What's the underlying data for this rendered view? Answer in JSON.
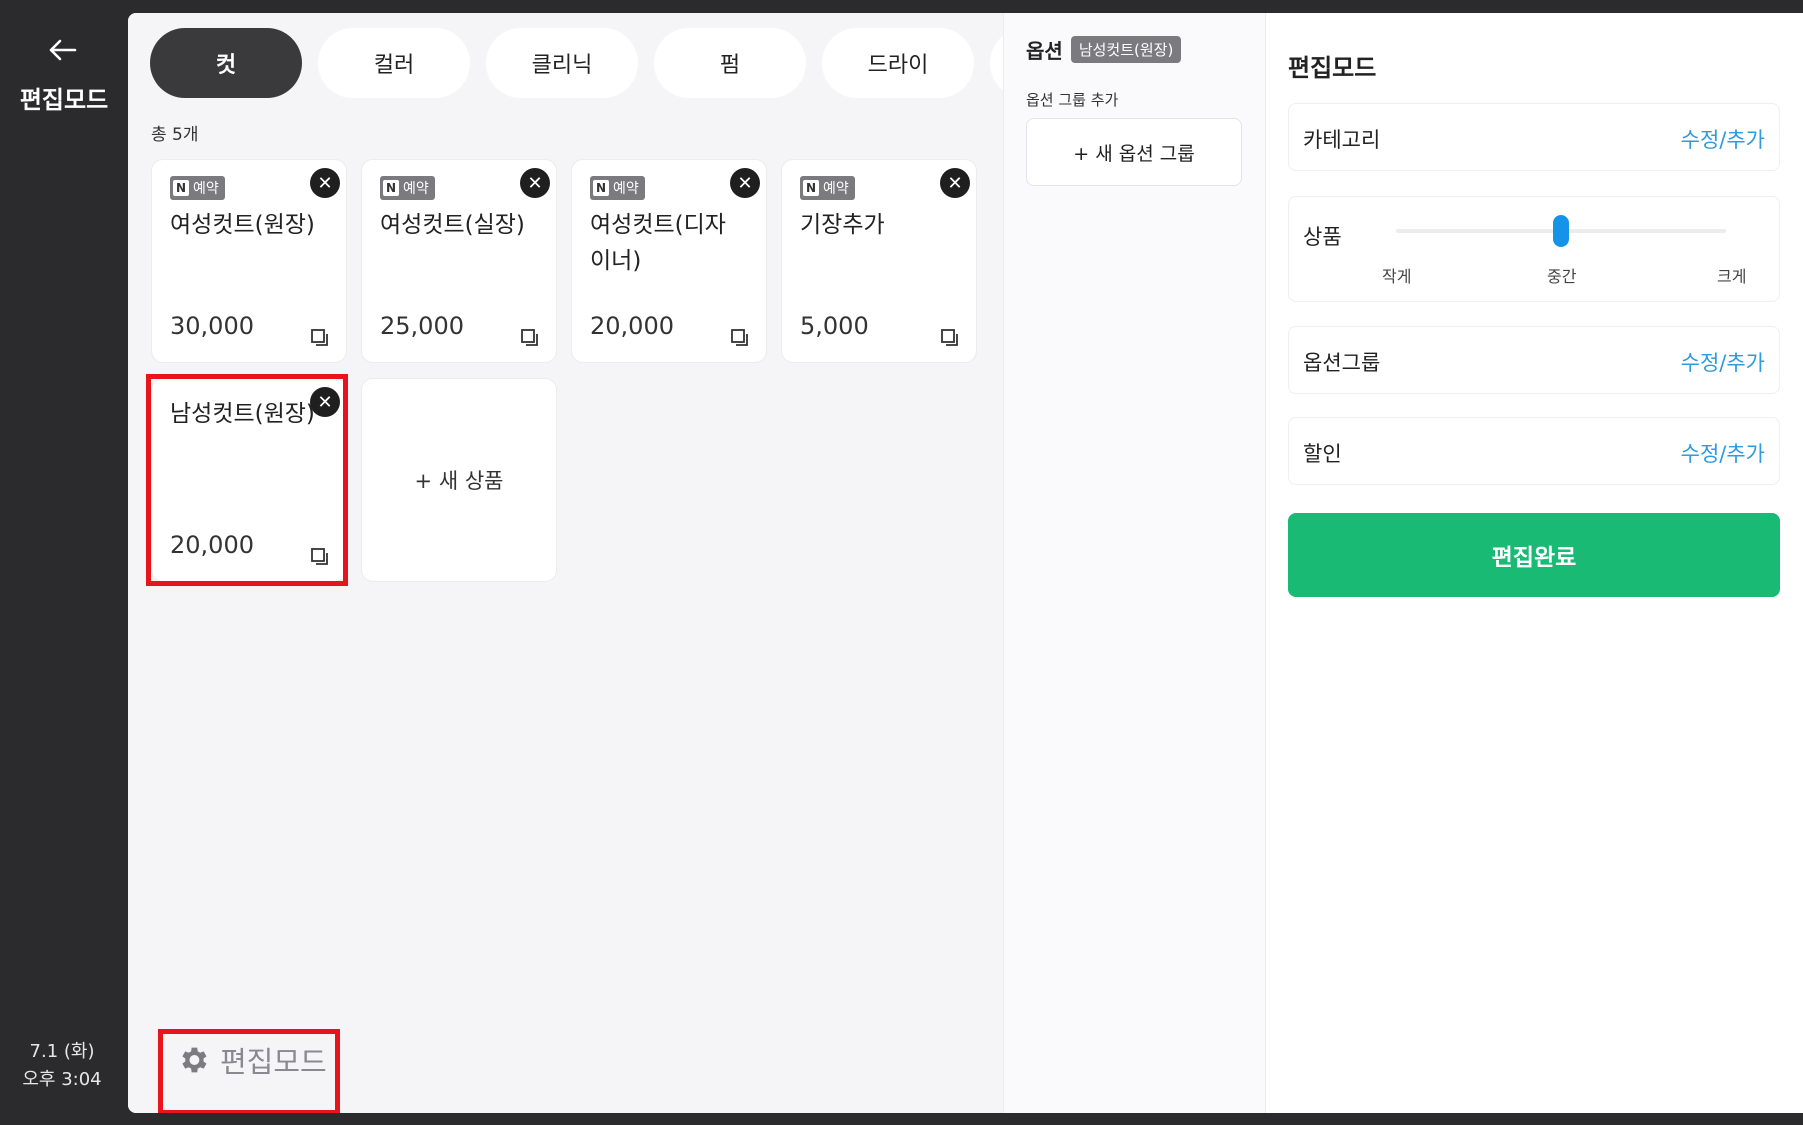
{
  "rail": {
    "title": "편집모드",
    "date": "7.1 (화)",
    "time": "오후 3:04"
  },
  "tabs": [
    "컷",
    "컬러",
    "클리닉",
    "펌",
    "드라이",
    ""
  ],
  "count_label": "총 5개",
  "products": [
    {
      "badge": "예약",
      "name": "여성컷트(원장)",
      "price": "30,000"
    },
    {
      "badge": "예약",
      "name": "여성컷트(실장)",
      "price": "25,000"
    },
    {
      "badge": "예약",
      "name": "여성컷트(디자이너)",
      "price": "20,000"
    },
    {
      "badge": "예약",
      "name": "기장추가",
      "price": "5,000"
    },
    {
      "badge": "",
      "name": "남성컷트(원장)",
      "price": "20,000"
    }
  ],
  "add_product_label": "+ 새 상품",
  "edit_mode_button": "편집모드",
  "options": {
    "title": "옵션",
    "selected_product": "남성컷트(원장)",
    "sub_label": "옵션 그룹 추가",
    "add_group_label": "+ 새 옵션 그룹"
  },
  "settings": {
    "title": "편집모드",
    "category": {
      "label": "카테고리",
      "action": "수정/추가"
    },
    "product": {
      "label": "상품",
      "size_small": "작게",
      "size_medium": "중간",
      "size_large": "크게",
      "selected": "중간"
    },
    "option_group": {
      "label": "옵션그룹",
      "action": "수정/추가"
    },
    "discount": {
      "label": "할인",
      "action": "수정/추가"
    },
    "done_button": "편집완료"
  },
  "colors": {
    "accent_blue": "#2d9be0",
    "done_green": "#18ba74",
    "highlight_red": "#e8141b",
    "rail_dark": "#2b2b2d"
  }
}
